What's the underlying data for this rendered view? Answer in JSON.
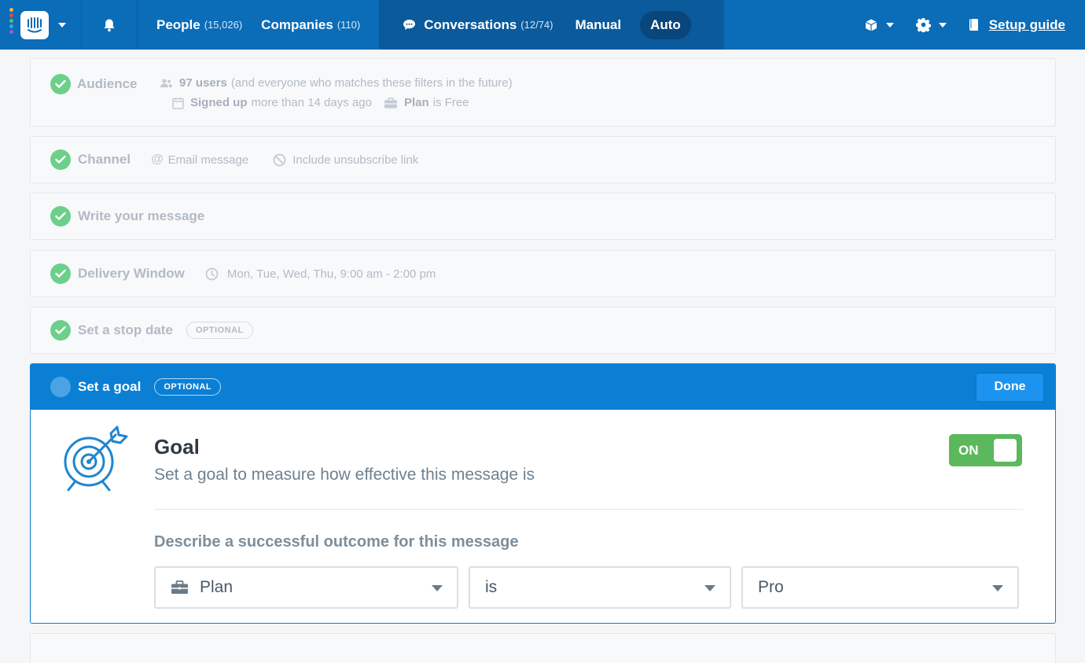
{
  "topnav": {
    "logo_colors": [
      "#f6b042",
      "#e4494e",
      "#5ebd5e",
      "#3ea4e0",
      "#9b5fc4"
    ],
    "people_label": "People",
    "people_count": "(15,026)",
    "companies_label": "Companies",
    "companies_count": "(110)",
    "conversations_label": "Conversations",
    "conversations_count": "(12/74)",
    "manual_label": "Manual",
    "auto_label": "Auto",
    "setup_guide_label": "Setup guide"
  },
  "steps": {
    "audience": {
      "title": "Audience",
      "users": "97 users",
      "users_note": "(and everyone who matches these filters in the future)",
      "filter1_attr": "Signed up",
      "filter1_rest": "more than 14 days ago",
      "filter2_attr": "Plan",
      "filter2_rest": "is Free"
    },
    "channel": {
      "title": "Channel",
      "email": "Email message",
      "unsubscribe": "Include unsubscribe link"
    },
    "message": {
      "title": "Write your message"
    },
    "delivery": {
      "title": "Delivery Window",
      "schedule": "Mon, Tue, Wed, Thu, 9:00 am - 2:00 pm"
    },
    "stop_date": {
      "title": "Set a stop date",
      "badge": "OPTIONAL"
    },
    "goal": {
      "title": "Set a goal",
      "badge": "OPTIONAL",
      "done_label": "Done",
      "heading": "Goal",
      "subheading": "Set a goal to measure how effective this message is",
      "toggle_label": "ON",
      "outcome_label": "Describe a successful outcome for this message",
      "attribute_value": "Plan",
      "operator_value": "is",
      "value": "Pro"
    }
  },
  "colors": {
    "nav": "#0b6cb8",
    "accent": "#0a7fd4",
    "check_green": "#6cd08b",
    "toggle_green": "#5cb85c"
  }
}
